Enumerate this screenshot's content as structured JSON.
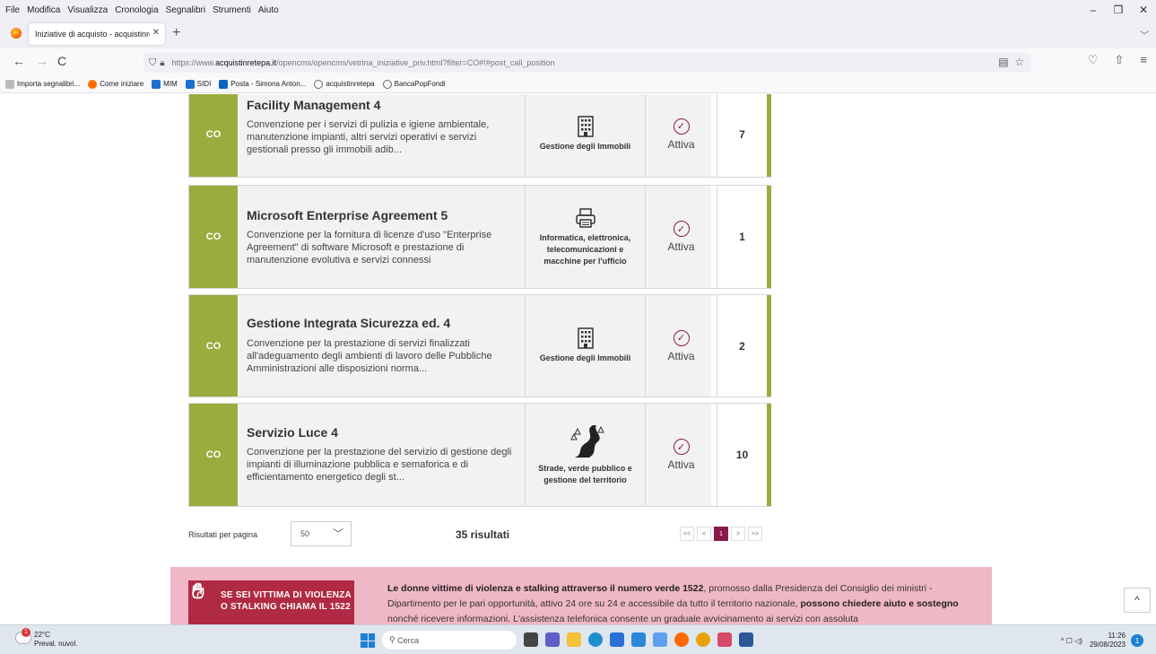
{
  "menubar": [
    "File",
    "Modifica",
    "Visualizza",
    "Cronologia",
    "Segnalibri",
    "Strumenti",
    "Aiuto"
  ],
  "window_controls": {
    "minimize": "–",
    "maximize": "❐",
    "close": "✕"
  },
  "tab": {
    "title": "Iniziative di acquisto - acquistinreteX",
    "close": "✕",
    "new_tab": "+",
    "list": "﹀"
  },
  "nav": {
    "back": "←",
    "forward": "→",
    "reload": "C"
  },
  "url": {
    "prefix": "https://www.",
    "domain": "acquistinretepa.it",
    "path": "/opencms/opencms/vetrina_iniziative_priv.html?filter=CO#!#post_call_position",
    "reader_icon": "▤",
    "bookmark_icon": "☆"
  },
  "toolbar_icons": {
    "pocket": "♡",
    "share": "⇧",
    "menu": "≡"
  },
  "bookmarks": [
    {
      "label": "Importa segnalibri...",
      "color": "#888888"
    },
    {
      "label": "Come iniziare",
      "color": "#ff6a00"
    },
    {
      "label": "MIM",
      "color": "#1c6fd1"
    },
    {
      "label": "SIDI",
      "color": "#1c6fd1"
    },
    {
      "label": "Posta - Simona Anton...",
      "color": "#0a64c0"
    },
    {
      "label": "acquistinretepa",
      "color": "#666666"
    },
    {
      "label": "BancaPopFondi",
      "color": "#666666"
    }
  ],
  "cards": [
    {
      "badge": "CO",
      "title": "Facility Management 4",
      "description": "Convenzione per i servizi di pulizia e igiene ambientale, manutenzione impianti, altri servizi operativi e servizi gestionali presso gli immobili adib...",
      "sector_icon": "building-icon",
      "sector": "Gestione degli Immobili",
      "status": "Attiva",
      "count": "7"
    },
    {
      "badge": "CO",
      "title": "Microsoft Enterprise Agreement 5",
      "description": "Convenzione per la fornitura di licenze d'uso \"Enterprise Agreement\" di software Microsoft e prestazione di manutenzione evolutiva e servizi connessi",
      "sector_icon": "printer-icon",
      "sector": "Informatica, elettronica, telecomunicazioni e macchine per l'ufficio",
      "status": "Attiva",
      "count": "1"
    },
    {
      "badge": "CO",
      "title": "Gestione Integrata Sicurezza ed. 4",
      "description": "Convenzione per la prestazione di servizi finalizzati all'adeguamento degli ambienti di lavoro delle Pubbliche Amministrazioni alle disposizioni norma...",
      "sector_icon": "building-icon",
      "sector": "Gestione degli Immobili",
      "status": "Attiva",
      "count": "2"
    },
    {
      "badge": "CO",
      "title": "Servizio Luce 4",
      "description": "Convenzione per la prestazione del servizio di gestione degli impianti di illuminazione pubblica e semaforica e di efficientamento energetico degli st...",
      "sector_icon": "road-icon",
      "sector": "Strade, verde pubblico e gestione del territorio",
      "status": "Attiva",
      "count": "10"
    }
  ],
  "pagination": {
    "rpp_label": "Risultati per pagina",
    "rpp_value": "50",
    "results": "35 risultati",
    "first": "<<",
    "prev": "<",
    "current": "1",
    "next": ">",
    "last": ">>"
  },
  "banner": {
    "image_text": "SE SEI VITTIMA DI VIOLENZA O STALKING CHIAMA IL 1522",
    "text_bold_1": "Le donne vittime di violenza e stalking attraverso il numero verde 1522",
    "text_1": ", promosso dalla Presidenza del Consiglio dei ministri - Dipartimento per le pari opportunità, attivo 24 ore su 24 e accessibile da tutto il territorio nazionale, ",
    "text_bold_2": "possono chiedere aiuto e sostegno",
    "text_2": " nonché ricevere informazioni. L'assistenza telefonica consente un graduale avvicinamento ai servizi con assoluta"
  },
  "scroll_top": "^",
  "taskbar": {
    "weather_temp": "22°C",
    "weather_desc": "Preval. nuvol.",
    "weather_alert": "1",
    "search_placeholder": "Cerca",
    "time": "11:26",
    "date": "29/08/2023",
    "notif": "1",
    "tray_icons": "^  ☐  ◁)"
  }
}
